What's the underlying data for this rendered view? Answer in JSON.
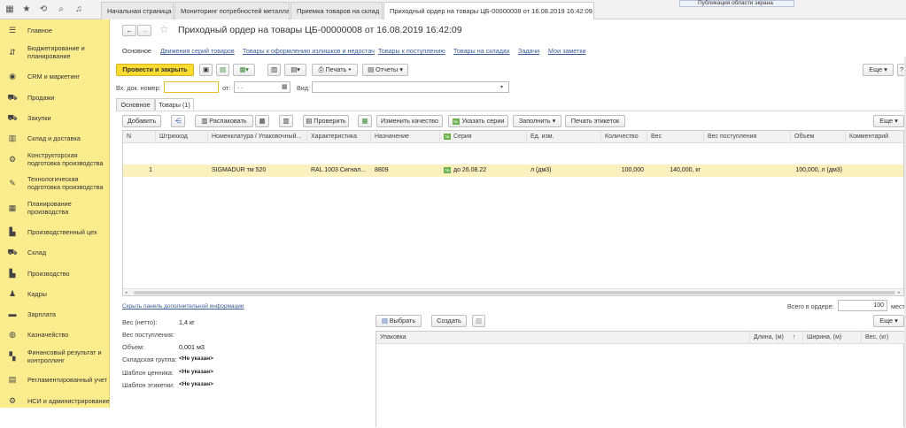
{
  "tabs": [
    {
      "label": "Начальная страница",
      "closable": false
    },
    {
      "label": "Мониторинг потребностей металла",
      "closable": true
    },
    {
      "label": "Приемка товаров на склад",
      "closable": true
    },
    {
      "label": "Приходный ордер на товары ЦБ-00000008 от 16.08.2019 16:42:09",
      "closable": true
    }
  ],
  "tooltip": "Публикация области экрана",
  "sidebar": {
    "items": [
      {
        "label": "Главное",
        "icon": "menu-icon"
      },
      {
        "label": "Бюджетирование и планирование",
        "icon": "budget-icon"
      },
      {
        "label": "CRM и маркетинг",
        "icon": "crm-icon"
      },
      {
        "label": "Продажи",
        "icon": "cart-icon"
      },
      {
        "label": "Закупки",
        "icon": "cart-icon"
      },
      {
        "label": "Склад и доставка",
        "icon": "warehouse-icon"
      },
      {
        "label": "Конструкторская подготовка производства",
        "icon": "design-icon"
      },
      {
        "label": "Технологическая подготовка производства",
        "icon": "tech-icon"
      },
      {
        "label": "Планирование производства",
        "icon": "planning-icon"
      },
      {
        "label": "Производственный цех",
        "icon": "factory-icon"
      },
      {
        "label": "Склад",
        "icon": "truck-icon"
      },
      {
        "label": "Производство",
        "icon": "production-icon"
      },
      {
        "label": "Кадры",
        "icon": "person-icon"
      },
      {
        "label": "Зарплата",
        "icon": "salary-icon"
      },
      {
        "label": "Казначейство",
        "icon": "treasury-icon"
      },
      {
        "label": "Финансовый результат и контроллинг",
        "icon": "finance-icon"
      },
      {
        "label": "Регламентированный учет",
        "icon": "accounting-icon"
      },
      {
        "label": "НСИ и администрирование",
        "icon": "admin-icon"
      }
    ]
  },
  "doc": {
    "title": "Приходный ордер на товары ЦБ-00000008 от 16.08.2019 16:42:09",
    "nav_links": [
      "Основное",
      "Движения серий товаров",
      "Товары к оформлению излишков и недостач",
      "Товары к поступлению",
      "Товары на складах",
      "Задачи",
      "Мои заметки"
    ],
    "toolbar": {
      "post_close": "Провести и закрыть",
      "print": "Печать",
      "reports": "Отчеты",
      "more": "Еще"
    },
    "fields": {
      "in_doc_number_label": "Вх. док. номер:",
      "in_doc_number_value": "",
      "from_label": "от:",
      "from_value": ". .",
      "type_label": "Вид:",
      "type_value": ""
    },
    "inner_tabs": [
      "Основное",
      "Товары (1)"
    ],
    "goods_toolbar": {
      "add": "Добавить",
      "unpack": "Распаковать",
      "check": "Проверить",
      "change_quality": "Изменить качество",
      "specify_series": "Указать серии",
      "fill": "Заполнить",
      "print_labels": "Печать этикеток",
      "more": "Еще"
    },
    "table": {
      "columns": [
        "N",
        "Штрихкод",
        "Номенклатура / Упаковочный...",
        "Характеристика",
        "Назначение",
        "Серия",
        "Ед. изм.",
        "Количество",
        "Вес",
        "Вес поступления",
        "Объем",
        "Комментарий"
      ],
      "rows": [
        {
          "n": "1",
          "barcode": "",
          "nomenclature": "SIGMADUR тм 520",
          "characteristic": "RAL 1003 Сигнал...",
          "purpose": "8809",
          "series": "до 26.08.22",
          "unit": "л (дм3)",
          "quantity": "100,000",
          "weight": "140,000, кг",
          "weight_in": "",
          "volume": "100,000, л (дм3)",
          "comment": ""
        }
      ]
    },
    "hide_panel_link": "Скрыть панель дополнительной информации",
    "total_label": "Всего в ордере:",
    "total_value": "100",
    "total_unit": "мест",
    "details": [
      {
        "label": "Вес (нетто):",
        "value": "1,4 кг"
      },
      {
        "label": "Вес поступления:",
        "value": ""
      },
      {
        "label": "Объем:",
        "value": "0,001 м3"
      },
      {
        "label": "Складская группа:",
        "value": "<Не указан>"
      },
      {
        "label": "Шаблон ценника:",
        "value": "<Не указан>"
      },
      {
        "label": "Шаблон этикетки:",
        "value": "<Не указан>"
      }
    ],
    "packing": {
      "select": "Выбрать",
      "create": "Создать",
      "more": "Еще",
      "columns": [
        "Упаковка",
        "Длина, (м)",
        "↑",
        "Ширина, (м)",
        "Вес, (кг)"
      ]
    }
  }
}
